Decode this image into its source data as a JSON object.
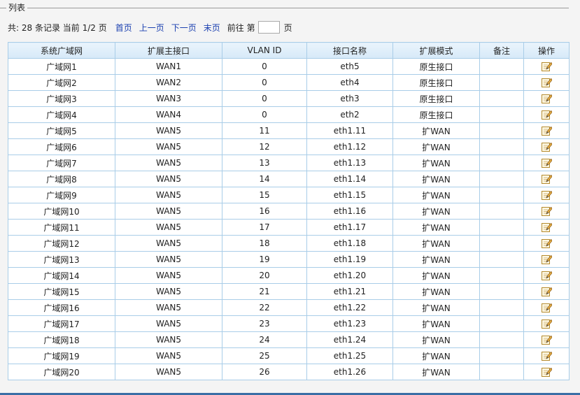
{
  "legend": "列表",
  "pager": {
    "summary": "共: 28 条记录 当前 1/2 页",
    "first": "首页",
    "prev": "上一页",
    "next": "下一页",
    "last": "末页",
    "goto_prefix": "前往 第",
    "goto_value": "",
    "goto_suffix": "页"
  },
  "table": {
    "headers": [
      "系统广域网",
      "扩展主接口",
      "VLAN ID",
      "接口名称",
      "扩展模式",
      "备注",
      "操作"
    ],
    "rows": [
      [
        "广域网1",
        "WAN1",
        "0",
        "eth5",
        "原生接口",
        ""
      ],
      [
        "广域网2",
        "WAN2",
        "0",
        "eth4",
        "原生接口",
        ""
      ],
      [
        "广域网3",
        "WAN3",
        "0",
        "eth3",
        "原生接口",
        ""
      ],
      [
        "广域网4",
        "WAN4",
        "0",
        "eth2",
        "原生接口",
        ""
      ],
      [
        "广域网5",
        "WAN5",
        "11",
        "eth1.11",
        "扩WAN",
        ""
      ],
      [
        "广域网6",
        "WAN5",
        "12",
        "eth1.12",
        "扩WAN",
        ""
      ],
      [
        "广域网7",
        "WAN5",
        "13",
        "eth1.13",
        "扩WAN",
        ""
      ],
      [
        "广域网8",
        "WAN5",
        "14",
        "eth1.14",
        "扩WAN",
        ""
      ],
      [
        "广域网9",
        "WAN5",
        "15",
        "eth1.15",
        "扩WAN",
        ""
      ],
      [
        "广域网10",
        "WAN5",
        "16",
        "eth1.16",
        "扩WAN",
        ""
      ],
      [
        "广域网11",
        "WAN5",
        "17",
        "eth1.17",
        "扩WAN",
        ""
      ],
      [
        "广域网12",
        "WAN5",
        "18",
        "eth1.18",
        "扩WAN",
        ""
      ],
      [
        "广域网13",
        "WAN5",
        "19",
        "eth1.19",
        "扩WAN",
        ""
      ],
      [
        "广域网14",
        "WAN5",
        "20",
        "eth1.20",
        "扩WAN",
        ""
      ],
      [
        "广域网15",
        "WAN5",
        "21",
        "eth1.21",
        "扩WAN",
        ""
      ],
      [
        "广域网16",
        "WAN5",
        "22",
        "eth1.22",
        "扩WAN",
        ""
      ],
      [
        "广域网17",
        "WAN5",
        "23",
        "eth1.23",
        "扩WAN",
        ""
      ],
      [
        "广域网18",
        "WAN5",
        "24",
        "eth1.24",
        "扩WAN",
        ""
      ],
      [
        "广域网19",
        "WAN5",
        "25",
        "eth1.25",
        "扩WAN",
        ""
      ],
      [
        "广域网20",
        "WAN5",
        "26",
        "eth1.26",
        "扩WAN",
        ""
      ]
    ],
    "action_icon": "edit-icon"
  },
  "colors": {
    "link": "#1a3fb0",
    "border": "#a9cde8",
    "header_bg": "#d6e9f8",
    "page_bg": "#f4f4f4",
    "accent_bar": "#3a6ea5"
  }
}
